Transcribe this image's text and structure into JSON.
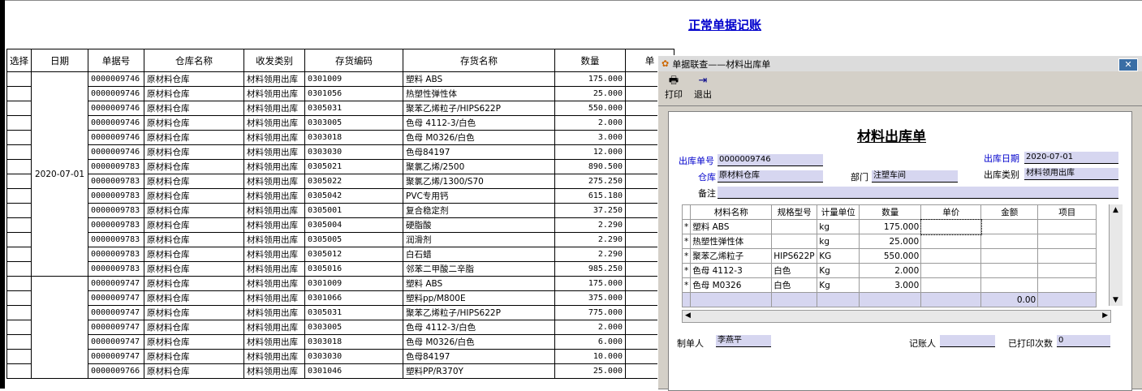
{
  "page_title": "正常单据记账",
  "columns": [
    "选择",
    "日期",
    "单据号",
    "仓库名称",
    "收发类别",
    "存货编码",
    "存货名称",
    "数量",
    "单"
  ],
  "group1_date": "2020-07-01",
  "rows": [
    {
      "no": "0000009746",
      "wh": "原材料仓库",
      "type": "材料领用出库",
      "code": "0301009",
      "name": "塑料 ABS",
      "qty": "175.000"
    },
    {
      "no": "0000009746",
      "wh": "原材料仓库",
      "type": "材料领用出库",
      "code": "0301056",
      "name": "热塑性弹性体",
      "qty": "25.000"
    },
    {
      "no": "0000009746",
      "wh": "原材料仓库",
      "type": "材料领用出库",
      "code": "0305031",
      "name": "聚苯乙烯粒子/HIPS622P",
      "qty": "550.000"
    },
    {
      "no": "0000009746",
      "wh": "原材料仓库",
      "type": "材料领用出库",
      "code": "0303005",
      "name": "色母 4112-3/白色",
      "qty": "2.000"
    },
    {
      "no": "0000009746",
      "wh": "原材料仓库",
      "type": "材料领用出库",
      "code": "0303018",
      "name": "色母 M0326/白色",
      "qty": "3.000"
    },
    {
      "no": "0000009746",
      "wh": "原材料仓库",
      "type": "材料领用出库",
      "code": "0303030",
      "name": "色母84197",
      "qty": "12.000"
    },
    {
      "no": "0000009783",
      "wh": "原材料仓库",
      "type": "材料领用出库",
      "code": "0305021",
      "name": "聚氯乙烯/2500",
      "qty": "890.500"
    },
    {
      "no": "0000009783",
      "wh": "原材料仓库",
      "type": "材料领用出库",
      "code": "0305022",
      "name": "聚氯乙烯/1300/S70",
      "qty": "275.250"
    },
    {
      "no": "0000009783",
      "wh": "原材料仓库",
      "type": "材料领用出库",
      "code": "0305042",
      "name": "PVC专用钙",
      "qty": "615.180"
    },
    {
      "no": "0000009783",
      "wh": "原材料仓库",
      "type": "材料领用出库",
      "code": "0305001",
      "name": "复合稳定剂",
      "qty": "37.250"
    },
    {
      "no": "0000009783",
      "wh": "原材料仓库",
      "type": "材料领用出库",
      "code": "0305004",
      "name": "硬脂酸",
      "qty": "2.290"
    },
    {
      "no": "0000009783",
      "wh": "原材料仓库",
      "type": "材料领用出库",
      "code": "0305005",
      "name": "润滑剂",
      "qty": "2.290"
    },
    {
      "no": "0000009783",
      "wh": "原材料仓库",
      "type": "材料领用出库",
      "code": "0305012",
      "name": "白石蜡",
      "qty": "2.290"
    },
    {
      "no": "0000009783",
      "wh": "原材料仓库",
      "type": "材料领用出库",
      "code": "0305016",
      "name": "邻苯二甲酸二辛脂",
      "qty": "985.250"
    },
    {
      "no": "0000009747",
      "wh": "原材料仓库",
      "type": "材料领用出库",
      "code": "0301009",
      "name": "塑料 ABS",
      "qty": "175.000"
    },
    {
      "no": "0000009747",
      "wh": "原材料仓库",
      "type": "材料领用出库",
      "code": "0301066",
      "name": "塑料pp/M800E",
      "qty": "375.000"
    },
    {
      "no": "0000009747",
      "wh": "原材料仓库",
      "type": "材料领用出库",
      "code": "0305031",
      "name": "聚苯乙烯粒子/HIPS622P",
      "qty": "775.000"
    },
    {
      "no": "0000009747",
      "wh": "原材料仓库",
      "type": "材料领用出库",
      "code": "0303005",
      "name": "色母 4112-3/白色",
      "qty": "2.000"
    },
    {
      "no": "0000009747",
      "wh": "原材料仓库",
      "type": "材料领用出库",
      "code": "0303018",
      "name": "色母 M0326/白色",
      "qty": "6.000"
    },
    {
      "no": "0000009747",
      "wh": "原材料仓库",
      "type": "材料领用出库",
      "code": "0303030",
      "name": "色母84197",
      "qty": "10.000"
    },
    {
      "no": "0000009766",
      "wh": "原材料仓库",
      "type": "材料领用出库",
      "code": "0301046",
      "name": "塑料PP/R370Y",
      "qty": "25.000"
    }
  ],
  "dialog": {
    "title": "单据联查——材料出库单",
    "toolbar": {
      "print": "打印",
      "exit": "退出"
    },
    "form_title": "材料出库单",
    "labels": {
      "doc_no": "出库单号",
      "warehouse": "仓库",
      "dept": "部门",
      "remark": "备注",
      "date": "出库日期",
      "category": "出库类别",
      "maker": "制单人",
      "bookkeeper": "记账人",
      "print_count": "已打印次数"
    },
    "values": {
      "doc_no": "0000009746",
      "warehouse": "原材料仓库",
      "dept": "注塑车间",
      "remark": "",
      "date": "2020-07-01",
      "category": "材料领用出库",
      "maker": "李燕平",
      "bookkeeper": "",
      "print_count": "0"
    },
    "columns": [
      "材料名称",
      "规格型号",
      "计量单位",
      "数量",
      "单价",
      "金额",
      "项目"
    ],
    "rows": [
      {
        "mark": "*",
        "name": "塑料 ABS",
        "spec": "",
        "unit": "kg",
        "qty": "175.000"
      },
      {
        "mark": "*",
        "name": "热塑性弹性体",
        "spec": "",
        "unit": "kg",
        "qty": "25.000"
      },
      {
        "mark": "*",
        "name": "聚苯乙烯粒子",
        "spec": "HIPS622P",
        "unit": "KG",
        "qty": "550.000"
      },
      {
        "mark": "*",
        "name": "色母 4112-3",
        "spec": "白色",
        "unit": "Kg",
        "qty": "2.000"
      },
      {
        "mark": "*",
        "name": "色母 M0326",
        "spec": "白色",
        "unit": "Kg",
        "qty": "3.000"
      }
    ],
    "total_amount": "0.00"
  }
}
